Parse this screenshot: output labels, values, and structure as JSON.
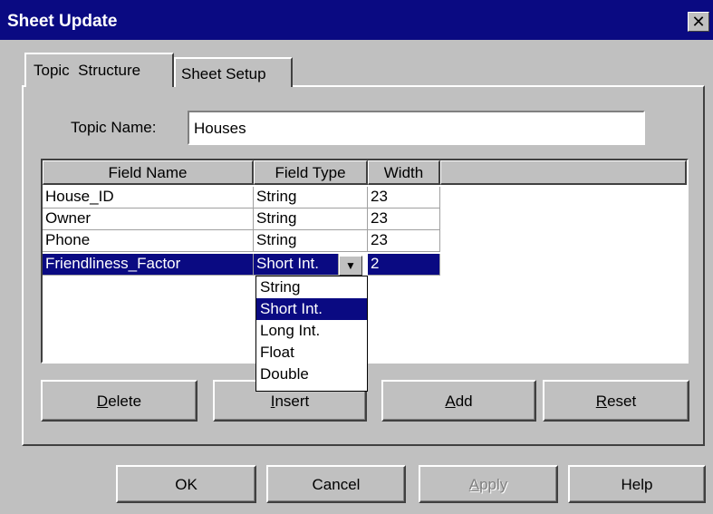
{
  "window": {
    "title": "Sheet Update",
    "close_glyph": "✕"
  },
  "tabs": [
    {
      "label": "Topic  Structure",
      "active": true
    },
    {
      "label": "Sheet Setup",
      "active": false
    }
  ],
  "topic": {
    "label": "Topic Name:",
    "value": "Houses"
  },
  "grid": {
    "columns": [
      "Field Name",
      "Field Type",
      "Width"
    ],
    "rows": [
      {
        "name": "House_ID",
        "type": "String",
        "width": "23",
        "selected": false
      },
      {
        "name": "Owner",
        "type": "String",
        "width": "23",
        "selected": false
      },
      {
        "name": "Phone",
        "type": "String",
        "width": "23",
        "selected": false
      },
      {
        "name": "Friendliness_Factor",
        "type": "Short Int.",
        "width": "2",
        "selected": true
      }
    ]
  },
  "dropdown": {
    "options": [
      "String",
      "Short Int.",
      "Long Int.",
      "Float",
      "Double"
    ],
    "selected": "Short Int.",
    "arrow_icon": "chevron-down-icon"
  },
  "actions": {
    "delete_rest": "elete",
    "delete_key": "D",
    "insert_rest": "nsert",
    "insert_key": "I",
    "add_rest": "dd",
    "add_key": "A",
    "reset_rest": "eset",
    "reset_key": "R"
  },
  "footer": {
    "ok": "OK",
    "cancel": "Cancel",
    "apply_key": "A",
    "apply_rest": "pply",
    "apply_disabled": true,
    "help": "Help"
  },
  "colors": {
    "selection": "#0a0a82",
    "face": "#c0c0c0",
    "titlebar": "#0a0a82"
  }
}
